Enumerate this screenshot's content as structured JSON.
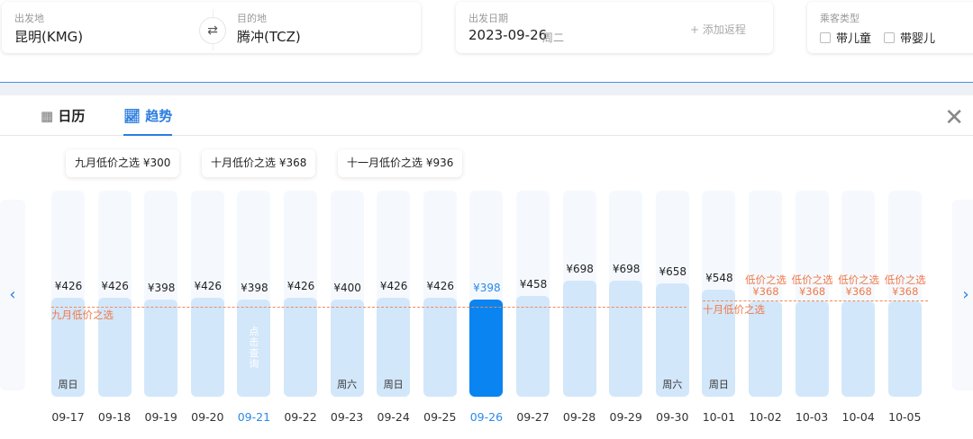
{
  "search": {
    "origin_label": "出发地",
    "origin": "昆明(KMG)",
    "dest_label": "目的地",
    "dest": "腾冲(TCZ)",
    "date_label": "出发日期",
    "date": "2023-09-26",
    "weekday": "周二",
    "add_return": "+ 添加返程",
    "pax_label": "乘客类型",
    "child": "带儿童",
    "infant": "带婴儿"
  },
  "tabs": [
    {
      "label": "日历"
    },
    {
      "label": "趋势"
    }
  ],
  "month_pills": [
    "九月低价之选 ¥300",
    "十月低价之选 ¥368",
    "十一月低价之选 ¥936"
  ],
  "sep_line_label": "九月低价之选",
  "oct_line_label": "十月低价之选",
  "click_hint": "点击查询",
  "low_tag": "低价之选",
  "accent": "#0a84f0",
  "days": [
    {
      "date": "09-17",
      "price": "¥426",
      "value": 426,
      "week": "周日"
    },
    {
      "date": "09-18",
      "price": "¥426",
      "value": 426
    },
    {
      "date": "09-19",
      "price": "¥398",
      "value": 398
    },
    {
      "date": "09-20",
      "price": "¥426",
      "value": 426
    },
    {
      "date": "09-21",
      "price": "¥398",
      "value": 398,
      "hint": true,
      "datesel": true
    },
    {
      "date": "09-22",
      "price": "¥426",
      "value": 426
    },
    {
      "date": "09-23",
      "price": "¥400",
      "value": 400,
      "week": "周六"
    },
    {
      "date": "09-24",
      "price": "¥426",
      "value": 426,
      "week": "周日"
    },
    {
      "date": "09-25",
      "price": "¥426",
      "value": 426
    },
    {
      "date": "09-26",
      "price": "¥398",
      "value": 398,
      "selected": true,
      "datesel": true
    },
    {
      "date": "09-27",
      "price": "¥458",
      "value": 458
    },
    {
      "date": "09-28",
      "price": "¥698",
      "value": 698
    },
    {
      "date": "09-29",
      "price": "¥698",
      "value": 698
    },
    {
      "date": "09-30",
      "price": "¥658",
      "value": 658,
      "week": "周六"
    },
    {
      "date": "10-01",
      "price": "¥548",
      "value": 548,
      "week": "周日"
    },
    {
      "date": "10-02",
      "price": "¥368",
      "value": 368,
      "low": true
    },
    {
      "date": "10-03",
      "price": "¥368",
      "value": 368,
      "low": true
    },
    {
      "date": "10-04",
      "price": "¥368",
      "value": 368,
      "low": true
    },
    {
      "date": "10-05",
      "price": "¥368",
      "value": 368,
      "low": true
    }
  ]
}
